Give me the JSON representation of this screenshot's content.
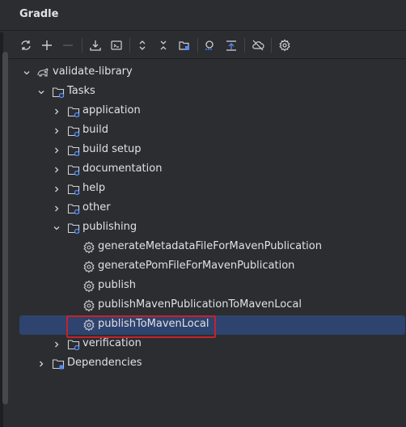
{
  "panel": {
    "title": "Gradle"
  },
  "toolbar": {
    "buttons": [
      {
        "icon": "refresh-icon"
      },
      {
        "icon": "plus-icon"
      },
      {
        "icon": "minus-icon"
      },
      {
        "icon": "download-icon"
      },
      {
        "icon": "run-task-icon"
      },
      {
        "icon": "expand-all-icon"
      },
      {
        "icon": "collapse-all-icon"
      },
      {
        "icon": "link-project-icon"
      },
      {
        "icon": "analyze-dependencies-icon"
      },
      {
        "icon": "show-source-icon"
      },
      {
        "icon": "offline-mode-icon"
      },
      {
        "icon": "settings-icon"
      }
    ]
  },
  "tree": {
    "root": {
      "label": "validate-library",
      "expanded": true
    },
    "tasks": {
      "label": "Tasks",
      "expanded": true
    },
    "groups": [
      {
        "label": "application",
        "expanded": false
      },
      {
        "label": "build",
        "expanded": false
      },
      {
        "label": "build setup",
        "expanded": false
      },
      {
        "label": "documentation",
        "expanded": false
      },
      {
        "label": "help",
        "expanded": false
      },
      {
        "label": "other",
        "expanded": false
      },
      {
        "label": "publishing",
        "expanded": true
      }
    ],
    "publishing_tasks": [
      {
        "label": "generateMetadataFileForMavenPublication"
      },
      {
        "label": "generatePomFileForMavenPublication"
      },
      {
        "label": "publish"
      },
      {
        "label": "publishMavenPublicationToMavenLocal"
      },
      {
        "label": "publishToMavenLocal",
        "selected": true
      }
    ],
    "verification": {
      "label": "verification",
      "expanded": false
    },
    "dependencies": {
      "label": "Dependencies",
      "expanded": false
    }
  },
  "colors": {
    "background": "#2b2d30",
    "selection": "#2e436e",
    "highlight_border": "#c7222a",
    "text": "#dfe1e5",
    "folder_accent": "#548af7"
  }
}
